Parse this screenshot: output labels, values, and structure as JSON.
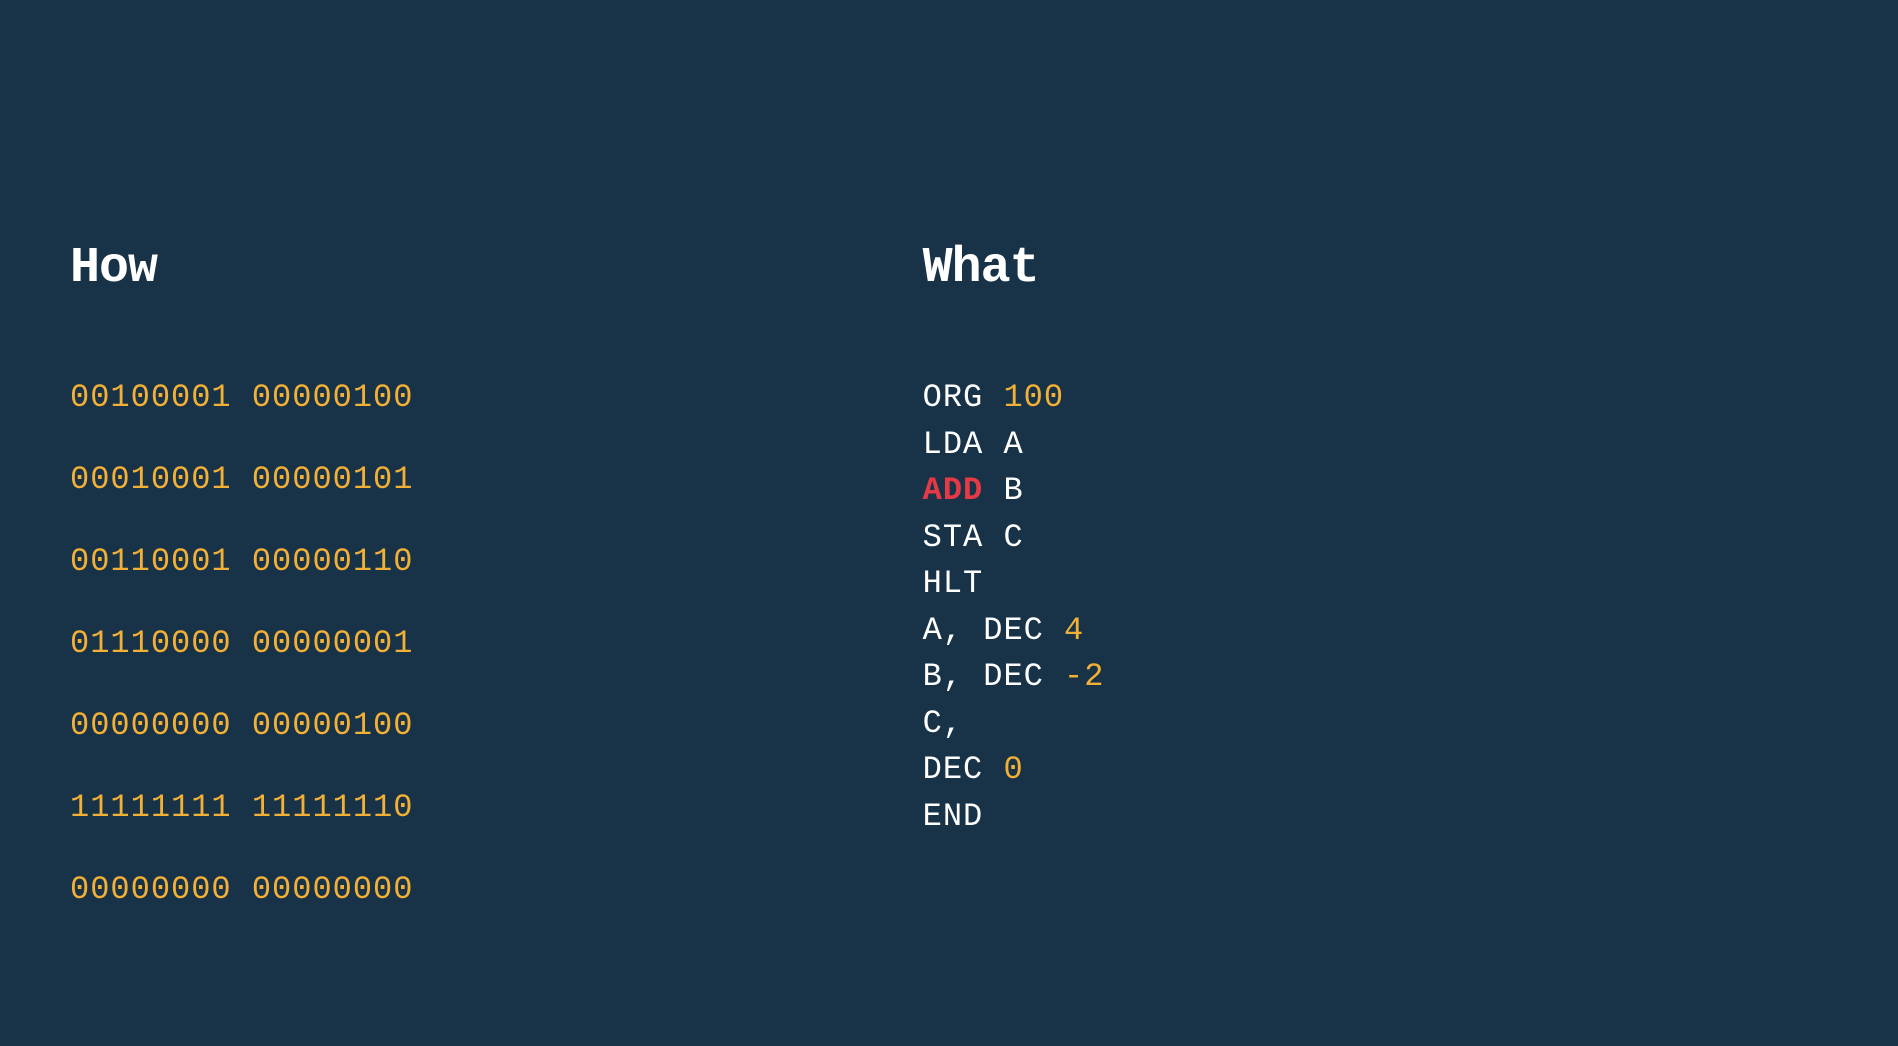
{
  "left": {
    "heading": "How",
    "binary_lines": [
      "00100001 00000100",
      "00010001 00000101",
      "00110001 00000110",
      "01110000 00000001",
      "00000000 00000100",
      "11111111 11111110",
      "00000000 00000000"
    ]
  },
  "right": {
    "heading": "What",
    "asm_lines": [
      {
        "tokens": [
          {
            "text": "ORG ",
            "cls": "asm-opcode"
          },
          {
            "text": "100",
            "cls": "asm-number"
          }
        ]
      },
      {
        "tokens": [
          {
            "text": "LDA A",
            "cls": "asm-opcode"
          }
        ]
      },
      {
        "tokens": [
          {
            "text": "ADD",
            "cls": "asm-keyword"
          },
          {
            "text": " B",
            "cls": "asm-operand"
          }
        ]
      },
      {
        "tokens": [
          {
            "text": "STA C",
            "cls": "asm-opcode"
          }
        ]
      },
      {
        "tokens": [
          {
            "text": "HLT",
            "cls": "asm-opcode"
          }
        ]
      },
      {
        "tokens": [
          {
            "text": "A",
            "cls": "asm-opcode"
          },
          {
            "text": ",",
            "cls": "asm-comma"
          },
          {
            "text": " DEC ",
            "cls": "asm-dec"
          },
          {
            "text": "4",
            "cls": "asm-number"
          }
        ]
      },
      {
        "tokens": [
          {
            "text": "B",
            "cls": "asm-opcode"
          },
          {
            "text": ",",
            "cls": "asm-comma"
          },
          {
            "text": " DEC ",
            "cls": "asm-dec"
          },
          {
            "text": "-2",
            "cls": "asm-number"
          }
        ]
      },
      {
        "tokens": [
          {
            "text": "C",
            "cls": "asm-opcode"
          },
          {
            "text": ",",
            "cls": "asm-comma"
          }
        ]
      },
      {
        "tokens": [
          {
            "text": "DEC ",
            "cls": "asm-dec"
          },
          {
            "text": "0",
            "cls": "asm-number"
          }
        ]
      },
      {
        "tokens": [
          {
            "text": "END",
            "cls": "asm-opcode"
          }
        ]
      }
    ]
  }
}
